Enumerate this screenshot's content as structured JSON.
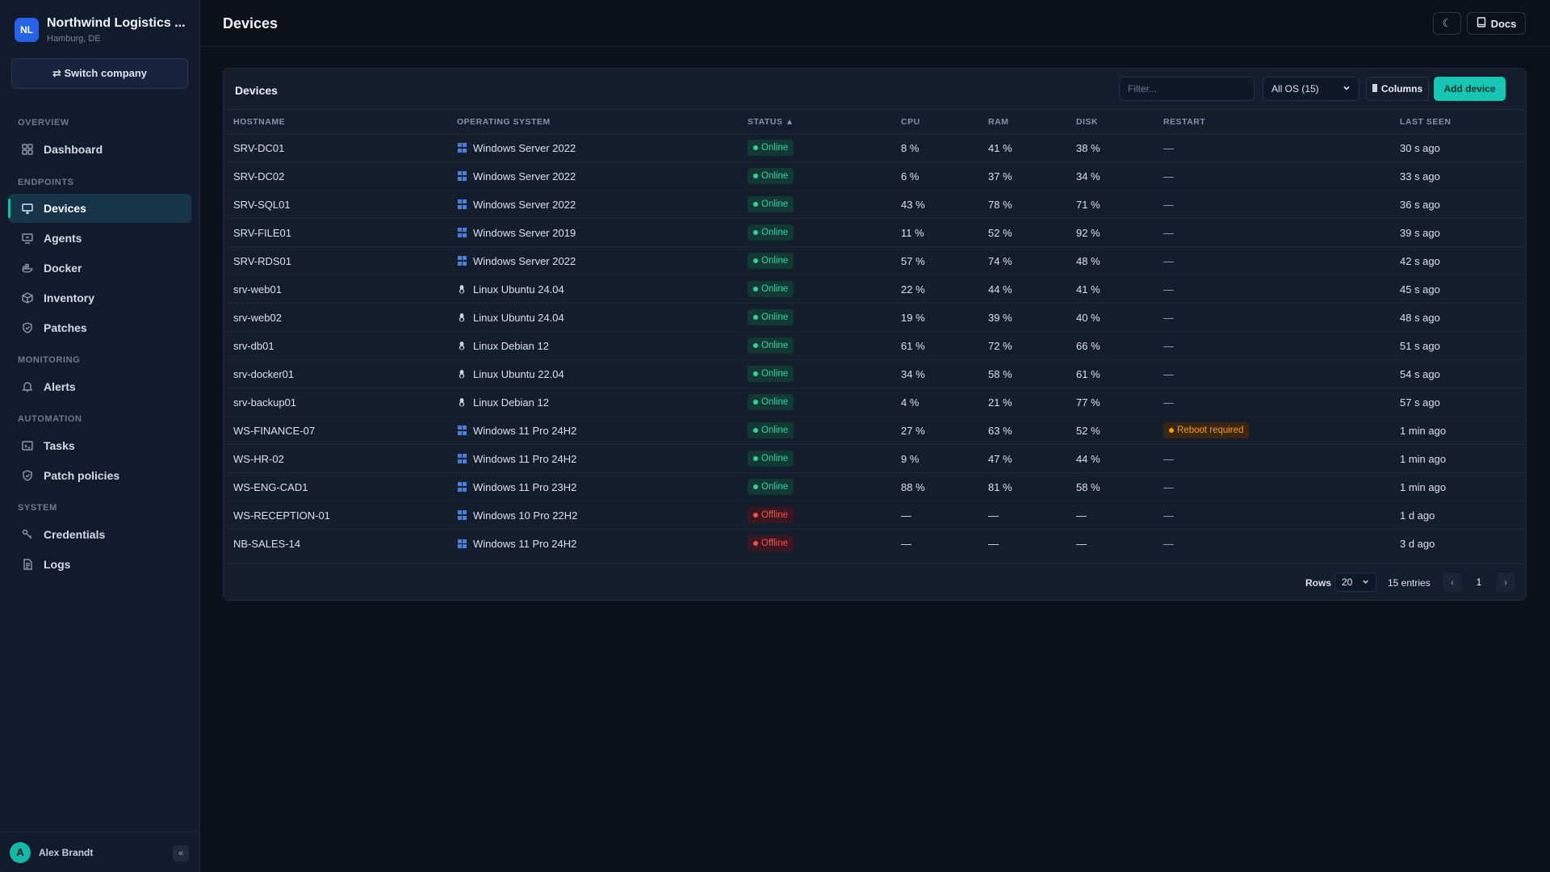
{
  "company": {
    "logo": "NL",
    "name": "Northwind Logistics ...",
    "location": "Hamburg, DE"
  },
  "switch_company": "⇄ Switch company",
  "nav": {
    "overview_label": "OVERVIEW",
    "endpoints_label": "ENDPOINTS",
    "monitoring_label": "MONITORING",
    "automation_label": "AUTOMATION",
    "system_label": "SYSTEM",
    "items": [
      {
        "label": "Dashboard",
        "icon": "grid-icon"
      },
      {
        "label": "Devices",
        "icon": "monitor-icon"
      },
      {
        "label": "Agents",
        "icon": "agent-icon"
      },
      {
        "label": "Docker",
        "icon": "docker-icon"
      },
      {
        "label": "Inventory",
        "icon": "box-icon"
      },
      {
        "label": "Patches",
        "icon": "shield-icon"
      },
      {
        "label": "Alerts",
        "icon": "bell-icon"
      },
      {
        "label": "Tasks",
        "icon": "terminal-icon"
      },
      {
        "label": "Patch policies",
        "icon": "shield-check-icon"
      },
      {
        "label": "Credentials",
        "icon": "key-icon"
      },
      {
        "label": "Logs",
        "icon": "file-icon"
      }
    ]
  },
  "user": {
    "initial": "A",
    "name": "Alex Brandt",
    "collapse": "«"
  },
  "header": {
    "title": "Devices",
    "theme_icon": "☾",
    "docs_label": "Docs"
  },
  "card": {
    "title": "Devices",
    "filter_placeholder": "Filter...",
    "os_filter": "All OS (15)",
    "columns_label": "Columns",
    "add_label": "Add device"
  },
  "table": {
    "headers": [
      "HOSTNAME",
      "OPERATING SYSTEM",
      "STATUS ▲",
      "CPU",
      "RAM",
      "DISK",
      "RESTART",
      "LAST SEEN"
    ],
    "rows": [
      {
        "host": "SRV-DC01",
        "os": "Windows Server 2022",
        "os_type": "windows",
        "status": "Online",
        "cpu": "8 %",
        "ram": "41 %",
        "disk": "38 %",
        "restart": "—",
        "seen": "30 s ago"
      },
      {
        "host": "SRV-DC02",
        "os": "Windows Server 2022",
        "os_type": "windows",
        "status": "Online",
        "cpu": "6 %",
        "ram": "37 %",
        "disk": "34 %",
        "restart": "—",
        "seen": "33 s ago"
      },
      {
        "host": "SRV-SQL01",
        "os": "Windows Server 2022",
        "os_type": "windows",
        "status": "Online",
        "cpu": "43 %",
        "ram": "78 %",
        "disk": "71 %",
        "restart": "—",
        "seen": "36 s ago"
      },
      {
        "host": "SRV-FILE01",
        "os": "Windows Server 2019",
        "os_type": "windows",
        "status": "Online",
        "cpu": "11 %",
        "ram": "52 %",
        "disk": "92 %",
        "restart": "—",
        "seen": "39 s ago"
      },
      {
        "host": "SRV-RDS01",
        "os": "Windows Server 2022",
        "os_type": "windows",
        "status": "Online",
        "cpu": "57 %",
        "ram": "74 %",
        "disk": "48 %",
        "restart": "—",
        "seen": "42 s ago"
      },
      {
        "host": "srv-web01",
        "os": "Linux Ubuntu 24.04",
        "os_type": "linux",
        "status": "Online",
        "cpu": "22 %",
        "ram": "44 %",
        "disk": "41 %",
        "restart": "—",
        "seen": "45 s ago"
      },
      {
        "host": "srv-web02",
        "os": "Linux Ubuntu 24.04",
        "os_type": "linux",
        "status": "Online",
        "cpu": "19 %",
        "ram": "39 %",
        "disk": "40 %",
        "restart": "—",
        "seen": "48 s ago"
      },
      {
        "host": "srv-db01",
        "os": "Linux Debian 12",
        "os_type": "linux",
        "status": "Online",
        "cpu": "61 %",
        "ram": "72 %",
        "disk": "66 %",
        "restart": "—",
        "seen": "51 s ago"
      },
      {
        "host": "srv-docker01",
        "os": "Linux Ubuntu 22.04",
        "os_type": "linux",
        "status": "Online",
        "cpu": "34 %",
        "ram": "58 %",
        "disk": "61 %",
        "restart": "—",
        "seen": "54 s ago"
      },
      {
        "host": "srv-backup01",
        "os": "Linux Debian 12",
        "os_type": "linux",
        "status": "Online",
        "cpu": "4 %",
        "ram": "21 %",
        "disk": "77 %",
        "restart": "—",
        "seen": "57 s ago"
      },
      {
        "host": "WS-FINANCE-07",
        "os": "Windows 11 Pro 24H2",
        "os_type": "windows",
        "status": "Online",
        "cpu": "27 %",
        "ram": "63 %",
        "disk": "52 %",
        "restart": "Reboot required",
        "seen": "1 min ago"
      },
      {
        "host": "WS-HR-02",
        "os": "Windows 11 Pro 24H2",
        "os_type": "windows",
        "status": "Online",
        "cpu": "9 %",
        "ram": "47 %",
        "disk": "44 %",
        "restart": "—",
        "seen": "1 min ago"
      },
      {
        "host": "WS-ENG-CAD1",
        "os": "Windows 11 Pro 23H2",
        "os_type": "windows",
        "status": "Online",
        "cpu": "88 %",
        "ram": "81 %",
        "disk": "58 %",
        "restart": "—",
        "seen": "1 min ago"
      },
      {
        "host": "WS-RECEPTION-01",
        "os": "Windows 10 Pro 22H2",
        "os_type": "windows",
        "status": "Offline",
        "cpu": "—",
        "ram": "—",
        "disk": "—",
        "restart": "—",
        "seen": "1 d ago"
      },
      {
        "host": "NB-SALES-14",
        "os": "Windows 11 Pro 24H2",
        "os_type": "windows",
        "status": "Offline",
        "cpu": "—",
        "ram": "—",
        "disk": "—",
        "restart": "—",
        "seen": "3 d ago"
      }
    ]
  },
  "footer": {
    "rows_label": "Rows",
    "rows_value": "20",
    "entries": "15 entries",
    "page": "1",
    "prev": "‹",
    "next": "›"
  },
  "colors": {
    "accent": "#14c6b3",
    "online": "#2dd4a6",
    "offline": "#f05252",
    "warning": "#f59e0b",
    "windows": "#3b82f6"
  }
}
